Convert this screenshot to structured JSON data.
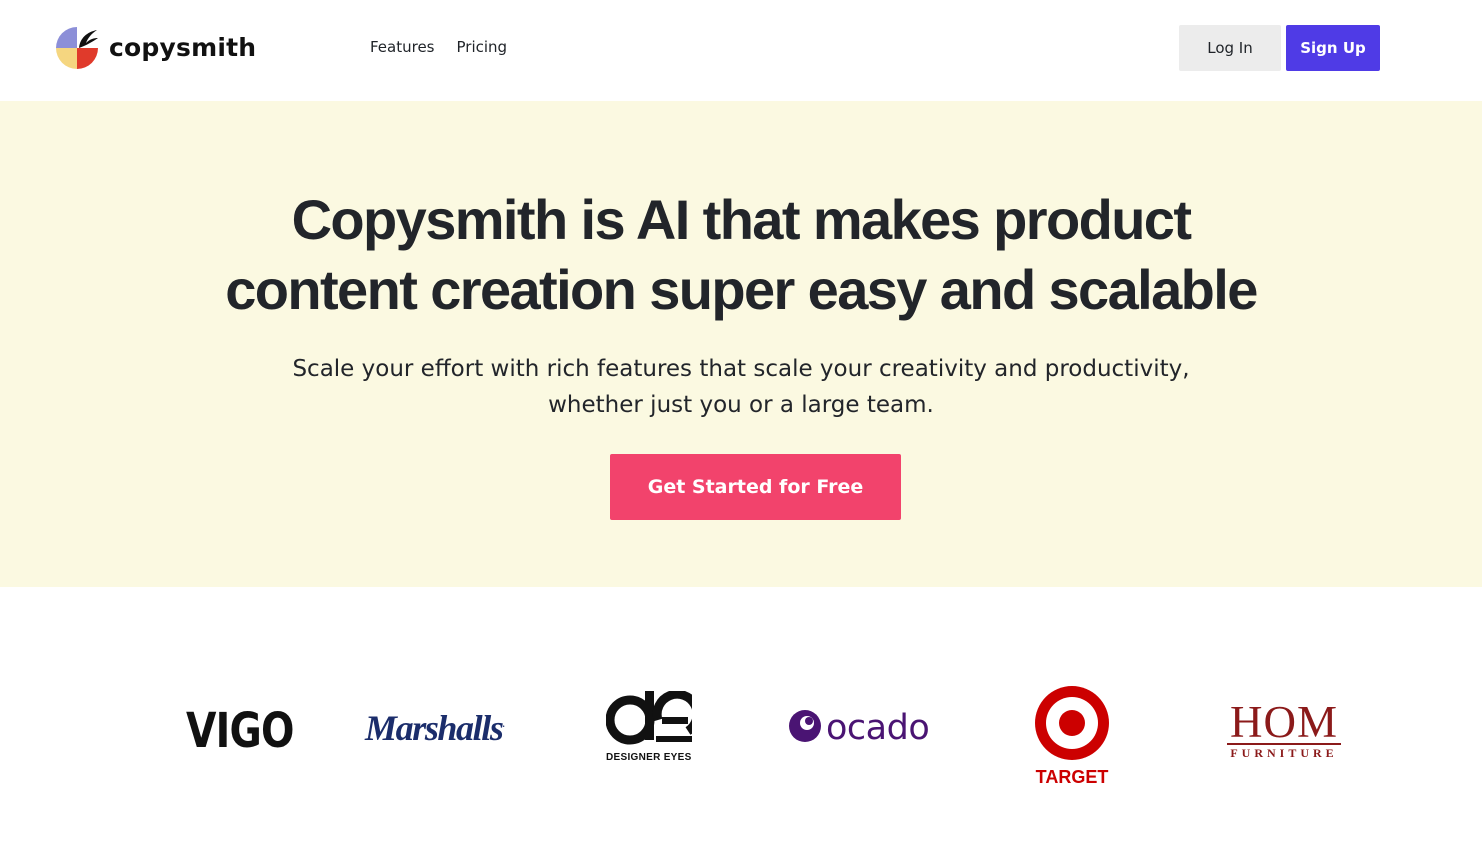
{
  "header": {
    "brand_name": "copysmith",
    "logo_icon": "copysmith-logo-icon",
    "nav": [
      {
        "label": "Features"
      },
      {
        "label": "Pricing"
      }
    ],
    "login_label": "Log In",
    "signup_label": "Sign Up"
  },
  "hero": {
    "title_line1": "Copysmith is AI that makes product",
    "title_line2": "content creation super easy and scalable",
    "subtitle_line1": "Scale your effort with rich features that scale your creativity and productivity,",
    "subtitle_line2": "whether just you or a large team.",
    "cta_label": "Get Started for Free"
  },
  "customer_logos": {
    "vigo": "VIGO",
    "marshalls": "Marshalls",
    "marshalls_mark": ".",
    "designer_eyes": "DESIGNER EYES",
    "ocado": "ocado",
    "target": "TARGET",
    "hom_main": "HOM",
    "hom_sub": "FURNITURE"
  },
  "colors": {
    "accent_primary": "#4f3be6",
    "cta": "#f2436c",
    "hero_background": "#fbf9e1",
    "text": "#22252a"
  }
}
